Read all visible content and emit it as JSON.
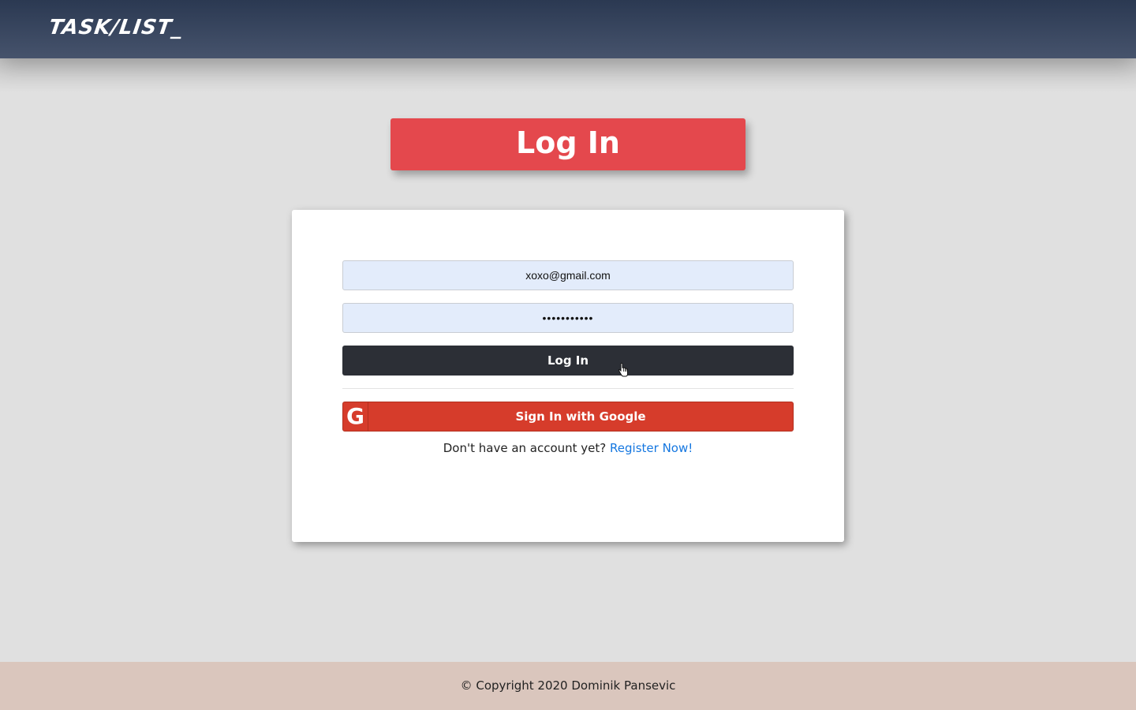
{
  "navbar": {
    "brand": "TASK/LIST_"
  },
  "page": {
    "title": "Log In"
  },
  "login_form": {
    "email_value": "xoxo@gmail.com",
    "password_value": "•••••••••••",
    "login_button_label": "Log In",
    "google_icon": "G",
    "google_button_label": "Sign In with Google",
    "register_prompt": "Don't have an account yet?",
    "register_link_label": "Register Now!"
  },
  "footer": {
    "copyright": "© Copyright 2020 Dominik Pansevic"
  },
  "colors": {
    "navbar": "#2b3952",
    "title_banner": "#e4484d",
    "login_button": "#2c2f36",
    "google_button": "#d63c2b",
    "link": "#1577e0",
    "footer": "#dac6bd"
  }
}
